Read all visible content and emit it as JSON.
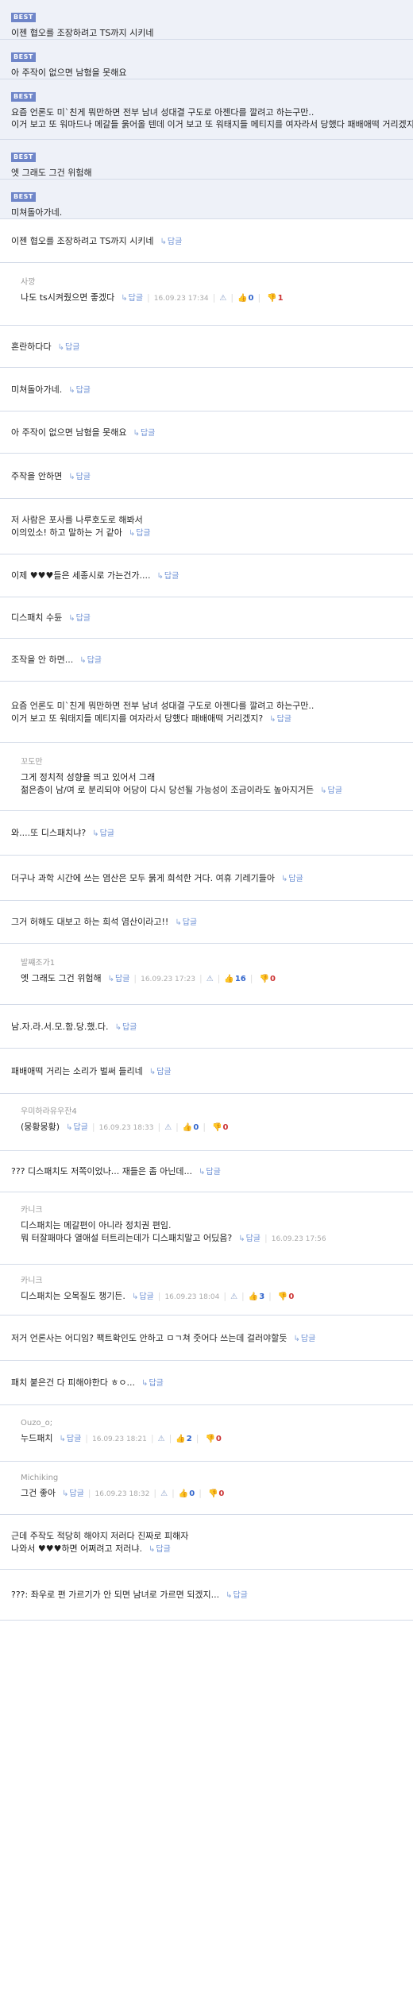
{
  "best_label": "BEST",
  "reply_label": "답글",
  "best": [
    {
      "text": "이젠 협오를 조장하려고 TS까지 시키네"
    },
    {
      "text": "아 주작이 없으면 남혐을 못해요"
    },
    {
      "lines": [
        "요즘 언론도 미`친게 뭐만하면 전부 남녀 성대결 구도로 아젠다를 깔려고 하는구만..",
        "이거 보고 또 워마드나 메갈들 욹어올 텐데 이거 보고 또 워태지들 메티지를 여자라서 당했다 패배애떡 거리겠지?"
      ]
    },
    {
      "text": "엣 그래도 그건 위험해"
    },
    {
      "text": "미쳐돌아가네."
    }
  ],
  "comments": [
    {
      "lines": [
        "이젠 협오를 조장하려고 TS까지 시키네"
      ]
    },
    {
      "nick": "사깡",
      "lines": [
        "나도 ts시켜줬으면 좋겠다"
      ],
      "date": "16.09.23 17:34",
      "up": "0",
      "down": "1"
    },
    {
      "lines": [
        "혼란하다다"
      ]
    },
    {
      "lines": [
        "미쳐돌아가네."
      ]
    },
    {
      "lines": [
        "아 주작이 없으면 남혐을 못해요"
      ]
    },
    {
      "lines": [
        "주작을 안하면"
      ]
    },
    {
      "lines": [
        "저 사람은 포사를 나루호도로 해봐서",
        "이의있소! 하고 말하는 거 같아"
      ]
    },
    {
      "lines": [
        "이제 ♥♥♥들은 세종시로 가는건가...."
      ]
    },
    {
      "lines": [
        "디스패치 수듄"
      ]
    },
    {
      "lines": [
        "조작을 안 하면..."
      ]
    },
    {
      "lines": [
        "요즘 언론도 미`친게 뭐만하면 전부 남녀 성대결 구도로 아젠다를 깔려고 하는구만..",
        "이거 보고 또 워태지들 메티지를 여자라서 당했다 패배애떡 거리겠지?"
      ]
    },
    {
      "nick": "꼬도만",
      "lines": [
        "그게 정치적 성향을 띄고 있어서 그래",
        "젊은층이 남/여 로 분리되야 어당이 다시 당선될 가능성이 조금이라도 높아지거든"
      ]
    },
    {
      "lines": [
        "와....또 디스패치냐?"
      ]
    },
    {
      "lines": [
        "더구나 과학 시간에 쓰는 염산은 모두 묽게 희석한 거다. 여휴 기레기들아"
      ]
    },
    {
      "lines": [
        "그거 허해도 대보고 하는 희석 염산이라고!!"
      ]
    },
    {
      "nick": "발쨰조가1",
      "lines": [
        "엣 그래도 그건 위험해"
      ],
      "date": "16.09.23 17:23",
      "up": "16",
      "down": "0"
    },
    {
      "lines": [
        "남.자.라.서.모.함.당.했.다."
      ]
    },
    {
      "lines": [
        "패배애떡 거리는 소리가 벌써 들리네"
      ]
    },
    {
      "nick": "우미하라유우잔4",
      "lines": [
        "(뭉황뭉황)"
      ],
      "date": "16.09.23 18:33",
      "up": "0",
      "down": "0"
    },
    {
      "lines": [
        "??? 디스패치도 저쪽이었나... 재들은 좀 아닌데..."
      ]
    },
    {
      "nick": "카니크",
      "lines": [
        "디스패치는 메갈편이 아니라 정치권 편임.",
        "뭐 터잘패마다 열애설 터트리는데가 디스패치말고 어딨음?"
      ],
      "date": "16.09.23 17:56"
    },
    {
      "nick": "카니크",
      "lines": [
        "디스패치는 오목질도 챙기든."
      ],
      "date": "16.09.23 18:04",
      "up": "3",
      "down": "0"
    },
    {
      "lines": [
        "저거 언론사는 어디임? 팩트확인도 안하고 ㅁㄱ쳐 줏어다 쓰는데 걸러야할듯"
      ]
    },
    {
      "lines": [
        "패치 붙은건 다 피해야한다 ㅎㅇ..."
      ]
    },
    {
      "nick": "Ouzo_o;",
      "lines": [
        "누드패치"
      ],
      "date": "16.09.23 18:21",
      "up": "2",
      "down": "0"
    },
    {
      "nick": "Michiking",
      "lines": [
        "그건 좋아"
      ],
      "date": "16.09.23 18:32",
      "up": "0",
      "down": "0"
    },
    {
      "lines": [
        "근데 주작도 적당히 해야지 저러다 진짜로 피해자",
        "나와서 ♥♥♥하면 어쩌려고 저러냐."
      ]
    },
    {
      "lines": [
        "???: 좌우로 편 가르기가 안 되면 남녀로 가르면 되겠지..."
      ]
    }
  ]
}
